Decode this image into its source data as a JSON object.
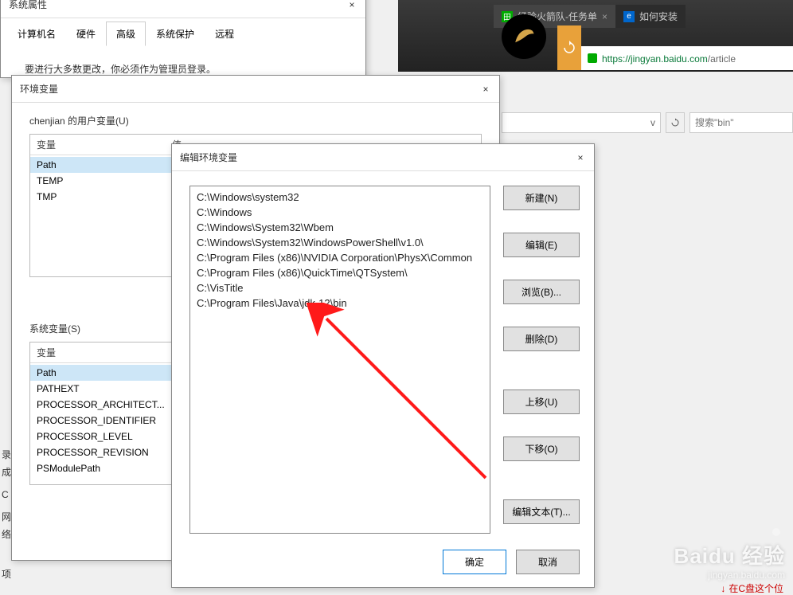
{
  "sysprops": {
    "title": "系统属性",
    "tabs": [
      "计算机名",
      "硬件",
      "高级",
      "系统保护",
      "远程"
    ],
    "active_tab": 2,
    "message": "要进行大多数更改，你必须作为管理员登录。"
  },
  "envvars": {
    "title": "环境变量",
    "user_section_label": "chenjian 的用户变量(U)",
    "sys_section_label": "系统变量(S)",
    "col_var": "变量",
    "col_val": "值",
    "user_vars": [
      "Path",
      "TEMP",
      "TMP"
    ],
    "user_selected": 0,
    "sys_vars": [
      "Path",
      "PATHEXT",
      "PROCESSOR_ARCHITECT...",
      "PROCESSOR_IDENTIFIER",
      "PROCESSOR_LEVEL",
      "PROCESSOR_REVISION",
      "PSModulePath"
    ],
    "sys_selected": 0
  },
  "editdlg": {
    "title": "编辑环境变量",
    "paths": [
      "C:\\Windows\\system32",
      "C:\\Windows",
      "C:\\Windows\\System32\\Wbem",
      "C:\\Windows\\System32\\WindowsPowerShell\\v1.0\\",
      "C:\\Program Files (x86)\\NVIDIA Corporation\\PhysX\\Common",
      "C:\\Program Files (x86)\\QuickTime\\QTSystem\\",
      "C:\\VisTitle",
      "C:\\Program Files\\Java\\jdk-12\\bin"
    ],
    "buttons": {
      "new": "新建(N)",
      "edit": "编辑(E)",
      "browse": "浏览(B)...",
      "delete": "删除(D)",
      "moveup": "上移(U)",
      "movedown": "下移(O)",
      "edittext": "编辑文本(T)..."
    },
    "ok": "确定",
    "cancel": "取消"
  },
  "browser": {
    "tabs": [
      {
        "label": "经验火箭队-任务单",
        "icon_color": "#0a0"
      },
      {
        "label": "如何安装",
        "icon_color": "#06c"
      }
    ],
    "url_host": "https://jingyan.baidu.com",
    "url_path": "/article"
  },
  "explorer": {
    "crumb_caret": "v",
    "search_placeholder": "搜索\"bin\""
  },
  "left_labels": [
    "录",
    "成",
    "C",
    "网络",
    "项"
  ],
  "watermark": {
    "brand": "Baidu 经验",
    "domain": "jingyan.baidu.com"
  },
  "bottom_note": "在C盘这个位"
}
